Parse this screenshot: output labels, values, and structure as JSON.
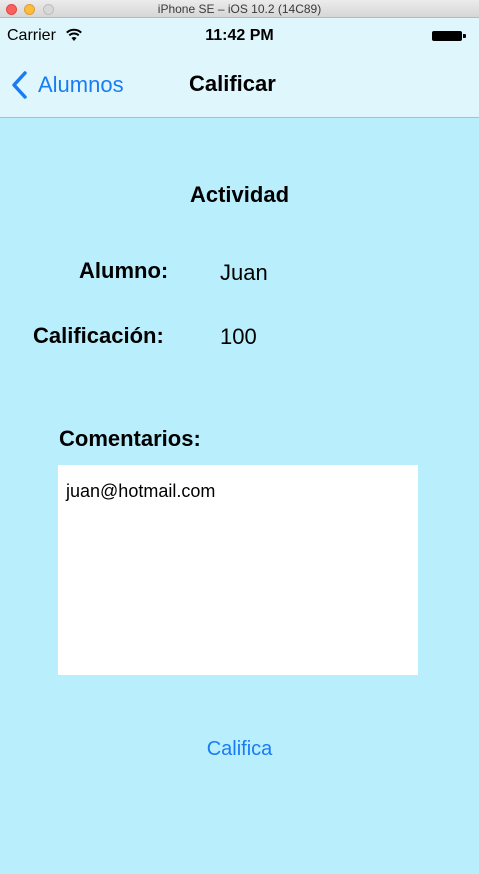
{
  "window": {
    "title": "iPhone SE – iOS 10.2 (14C89)"
  },
  "status_bar": {
    "carrier": "Carrier",
    "time": "11:42 PM"
  },
  "nav": {
    "back_label": "Alumnos",
    "title": "Calificar"
  },
  "content": {
    "heading": "Actividad",
    "student_label": "Alumno:",
    "student_value": "Juan",
    "grade_label": "Calificación:",
    "grade_value": "100",
    "comments_label": "Comentarios:",
    "comments_value": "juan@hotmail.com",
    "submit_label": "Califica"
  },
  "colors": {
    "background": "#b9effc",
    "nav_background": "#dff7fc",
    "accent": "#1a7cf4"
  }
}
